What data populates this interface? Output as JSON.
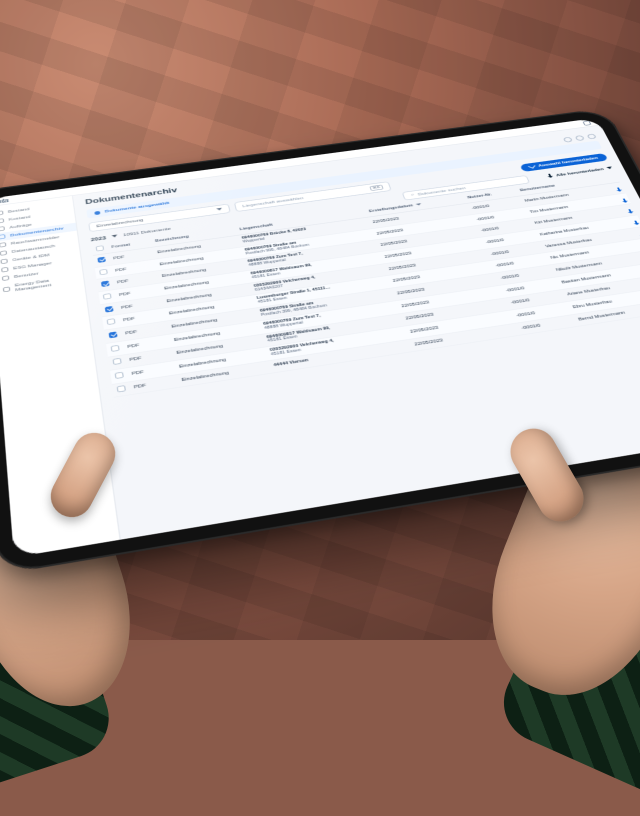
{
  "brand": "ista",
  "nav": [
    {
      "label": "Bestand"
    },
    {
      "label": "Kostand"
    },
    {
      "label": "Aufträge"
    },
    {
      "label": "Dokumentenarchiv",
      "active": true
    },
    {
      "label": "Rauchwarnmelder"
    },
    {
      "label": "Datenaustausch"
    },
    {
      "label": "Geräte & IDM"
    },
    {
      "label": "ESG Manager"
    },
    {
      "label": "Benutzer"
    },
    {
      "label": "Energy Data Management"
    }
  ],
  "page": {
    "title": "Dokumentenarchiv",
    "banner": "Dokumente ausgewählt",
    "filter_doc_type": "Einzelabrechnung",
    "filter_property_placeholder": "Liegenschaft auswählen",
    "download_selection": "Auswahl herunterladen",
    "year": "2023",
    "count": "10911 Dokumente",
    "search_placeholder": "Dokumente suchen",
    "download_all": "Alle herunterladen"
  },
  "columns": {
    "format": "Format",
    "bez": "Bezeichnung",
    "liegenschaft": "Liegenschaft",
    "erstell": "Erstellungsdatum",
    "nutzer": "Nutzer-Nr.",
    "benutzer": "Benutzername"
  },
  "rows": [
    {
      "sel": true,
      "fmt": "PDF",
      "bez": "Einzelabrechnung",
      "l1": "6946000769 Brücke 8, 42023",
      "l2": "Wuppertal",
      "date": "22/05/2023",
      "nut": "-0001/0",
      "user": "Martin Mustermann"
    },
    {
      "sel": false,
      "fmt": "PDF",
      "bez": "Einzelabrechnung",
      "l1": "6946000769 Straße am",
      "l2": "Postfach 995, 48484 Bochum",
      "date": "22/05/2023",
      "nut": "-0001/0",
      "user": "Tim Mustermann"
    },
    {
      "sel": true,
      "fmt": "PDF",
      "bez": "Einzelabrechnung",
      "l1": "6946000769 Zum Test 7,",
      "l2": "48888 Wuppertal",
      "date": "22/05/2023",
      "nut": "-0001/0",
      "user": "Kiri Mustermann"
    },
    {
      "sel": false,
      "fmt": "PDF",
      "bez": "Einzelabrechnung",
      "l1": "6946009817 Waldsaum 99,",
      "l2": "45181 Essen",
      "date": "22/05/2023",
      "nut": "-0001/0",
      "user": "Katharina Musterfrau"
    },
    {
      "sel": true,
      "fmt": "PDF",
      "bez": "Einzelabrechnung",
      "l1": "0305292900 Velcherweg 4,",
      "l2": "61434A0207",
      "date": "22/05/2023",
      "nut": "-0001/0",
      "user": "Vanessa Musterfrau"
    },
    {
      "sel": false,
      "fmt": "PDF",
      "bez": "Einzelabrechnung",
      "l1": "Luxemburger Straße 1, 45111…",
      "l2": "45181 Essen",
      "date": "22/05/2023",
      "nut": "-0001/0",
      "user": "Nic Mustermann"
    },
    {
      "sel": true,
      "fmt": "PDF",
      "bez": "Einzelabrechnung",
      "l1": "6946000769 Straße am",
      "l2": "Postfach 399, 48484 Bochum",
      "date": "22/05/2023",
      "nut": "-0001/0",
      "user": "Nikolir Mustermann"
    },
    {
      "sel": false,
      "fmt": "PDF",
      "bez": "Einzelabrechnung",
      "l1": "6946000769 Zum Test 7,",
      "l2": "48888 Wuppertal",
      "date": "22/05/2023",
      "nut": "-0001/0",
      "user": "Bastian Mustermann"
    },
    {
      "sel": false,
      "fmt": "PDF",
      "bez": "Einzelabrechnung",
      "l1": "6946009817 Waldsaum 99,",
      "l2": "45181 Essen",
      "date": "22/05/2023",
      "nut": "-0001/0",
      "user": "Ariane Musterfrau"
    },
    {
      "sel": false,
      "fmt": "PDF",
      "bez": "Einzelabrechnung",
      "l1": "0305292900 Velcherweg 4,",
      "l2": "45181 Essen",
      "date": "22/05/2023",
      "nut": "-0001/0",
      "user": "Ebru Musterfrau"
    },
    {
      "sel": false,
      "fmt": "PDF",
      "bez": "Einzelabrechnung",
      "l1": "44444 Viersen",
      "l2": "",
      "date": "22/05/2023",
      "nut": "-0001/0",
      "user": "Bernd Mustermann"
    }
  ]
}
